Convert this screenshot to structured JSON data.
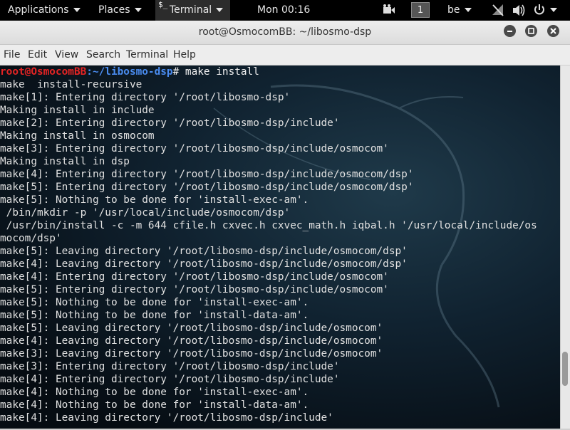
{
  "top_panel": {
    "applications": "Applications",
    "places": "Places",
    "terminal_glyph": "$_",
    "terminal": "Terminal",
    "clock": "Mon 00:16",
    "workspace": "1",
    "keyboard_layout": "be"
  },
  "window": {
    "title": "root@OsmocomBB: ~/libosmo-dsp"
  },
  "menubar": [
    "File",
    "Edit",
    "View",
    "Search",
    "Terminal",
    "Help"
  ],
  "terminal": {
    "prompt_user": "root@OsmocomBB",
    "prompt_path": ":~/libosmo-dsp",
    "prompt_cmd": "# make install",
    "lines": [
      "make  install-recursive",
      "make[1]: Entering directory '/root/libosmo-dsp'",
      "Making install in include",
      "make[2]: Entering directory '/root/libosmo-dsp/include'",
      "Making install in osmocom",
      "make[3]: Entering directory '/root/libosmo-dsp/include/osmocom'",
      "Making install in dsp",
      "make[4]: Entering directory '/root/libosmo-dsp/include/osmocom/dsp'",
      "make[5]: Entering directory '/root/libosmo-dsp/include/osmocom/dsp'",
      "make[5]: Nothing to be done for 'install-exec-am'.",
      " /bin/mkdir -p '/usr/local/include/osmocom/dsp'",
      " /usr/bin/install -c -m 644 cfile.h cxvec.h cxvec_math.h iqbal.h '/usr/local/include/os",
      "mocom/dsp'",
      "make[5]: Leaving directory '/root/libosmo-dsp/include/osmocom/dsp'",
      "make[4]: Leaving directory '/root/libosmo-dsp/include/osmocom/dsp'",
      "make[4]: Entering directory '/root/libosmo-dsp/include/osmocom'",
      "make[5]: Entering directory '/root/libosmo-dsp/include/osmocom'",
      "make[5]: Nothing to be done for 'install-exec-am'.",
      "make[5]: Nothing to be done for 'install-data-am'.",
      "make[5]: Leaving directory '/root/libosmo-dsp/include/osmocom'",
      "make[4]: Leaving directory '/root/libosmo-dsp/include/osmocom'",
      "make[3]: Leaving directory '/root/libosmo-dsp/include/osmocom'",
      "make[3]: Entering directory '/root/libosmo-dsp/include'",
      "make[4]: Entering directory '/root/libosmo-dsp/include'",
      "make[4]: Nothing to be done for 'install-exec-am'.",
      "make[4]: Nothing to be done for 'install-data-am'.",
      "make[4]: Leaving directory '/root/libosmo-dsp/include'"
    ]
  },
  "icons": [
    "chevron-down-icon",
    "video-camera-icon",
    "network-disabled-icon",
    "volume-icon",
    "power-icon",
    "minimize-icon",
    "maximize-icon",
    "close-icon"
  ],
  "colors": {
    "prompt_user": "#e52424",
    "prompt_path": "#4a8cf0",
    "terminal_text": "#e0e0e0",
    "panel_bg": "#000000"
  }
}
